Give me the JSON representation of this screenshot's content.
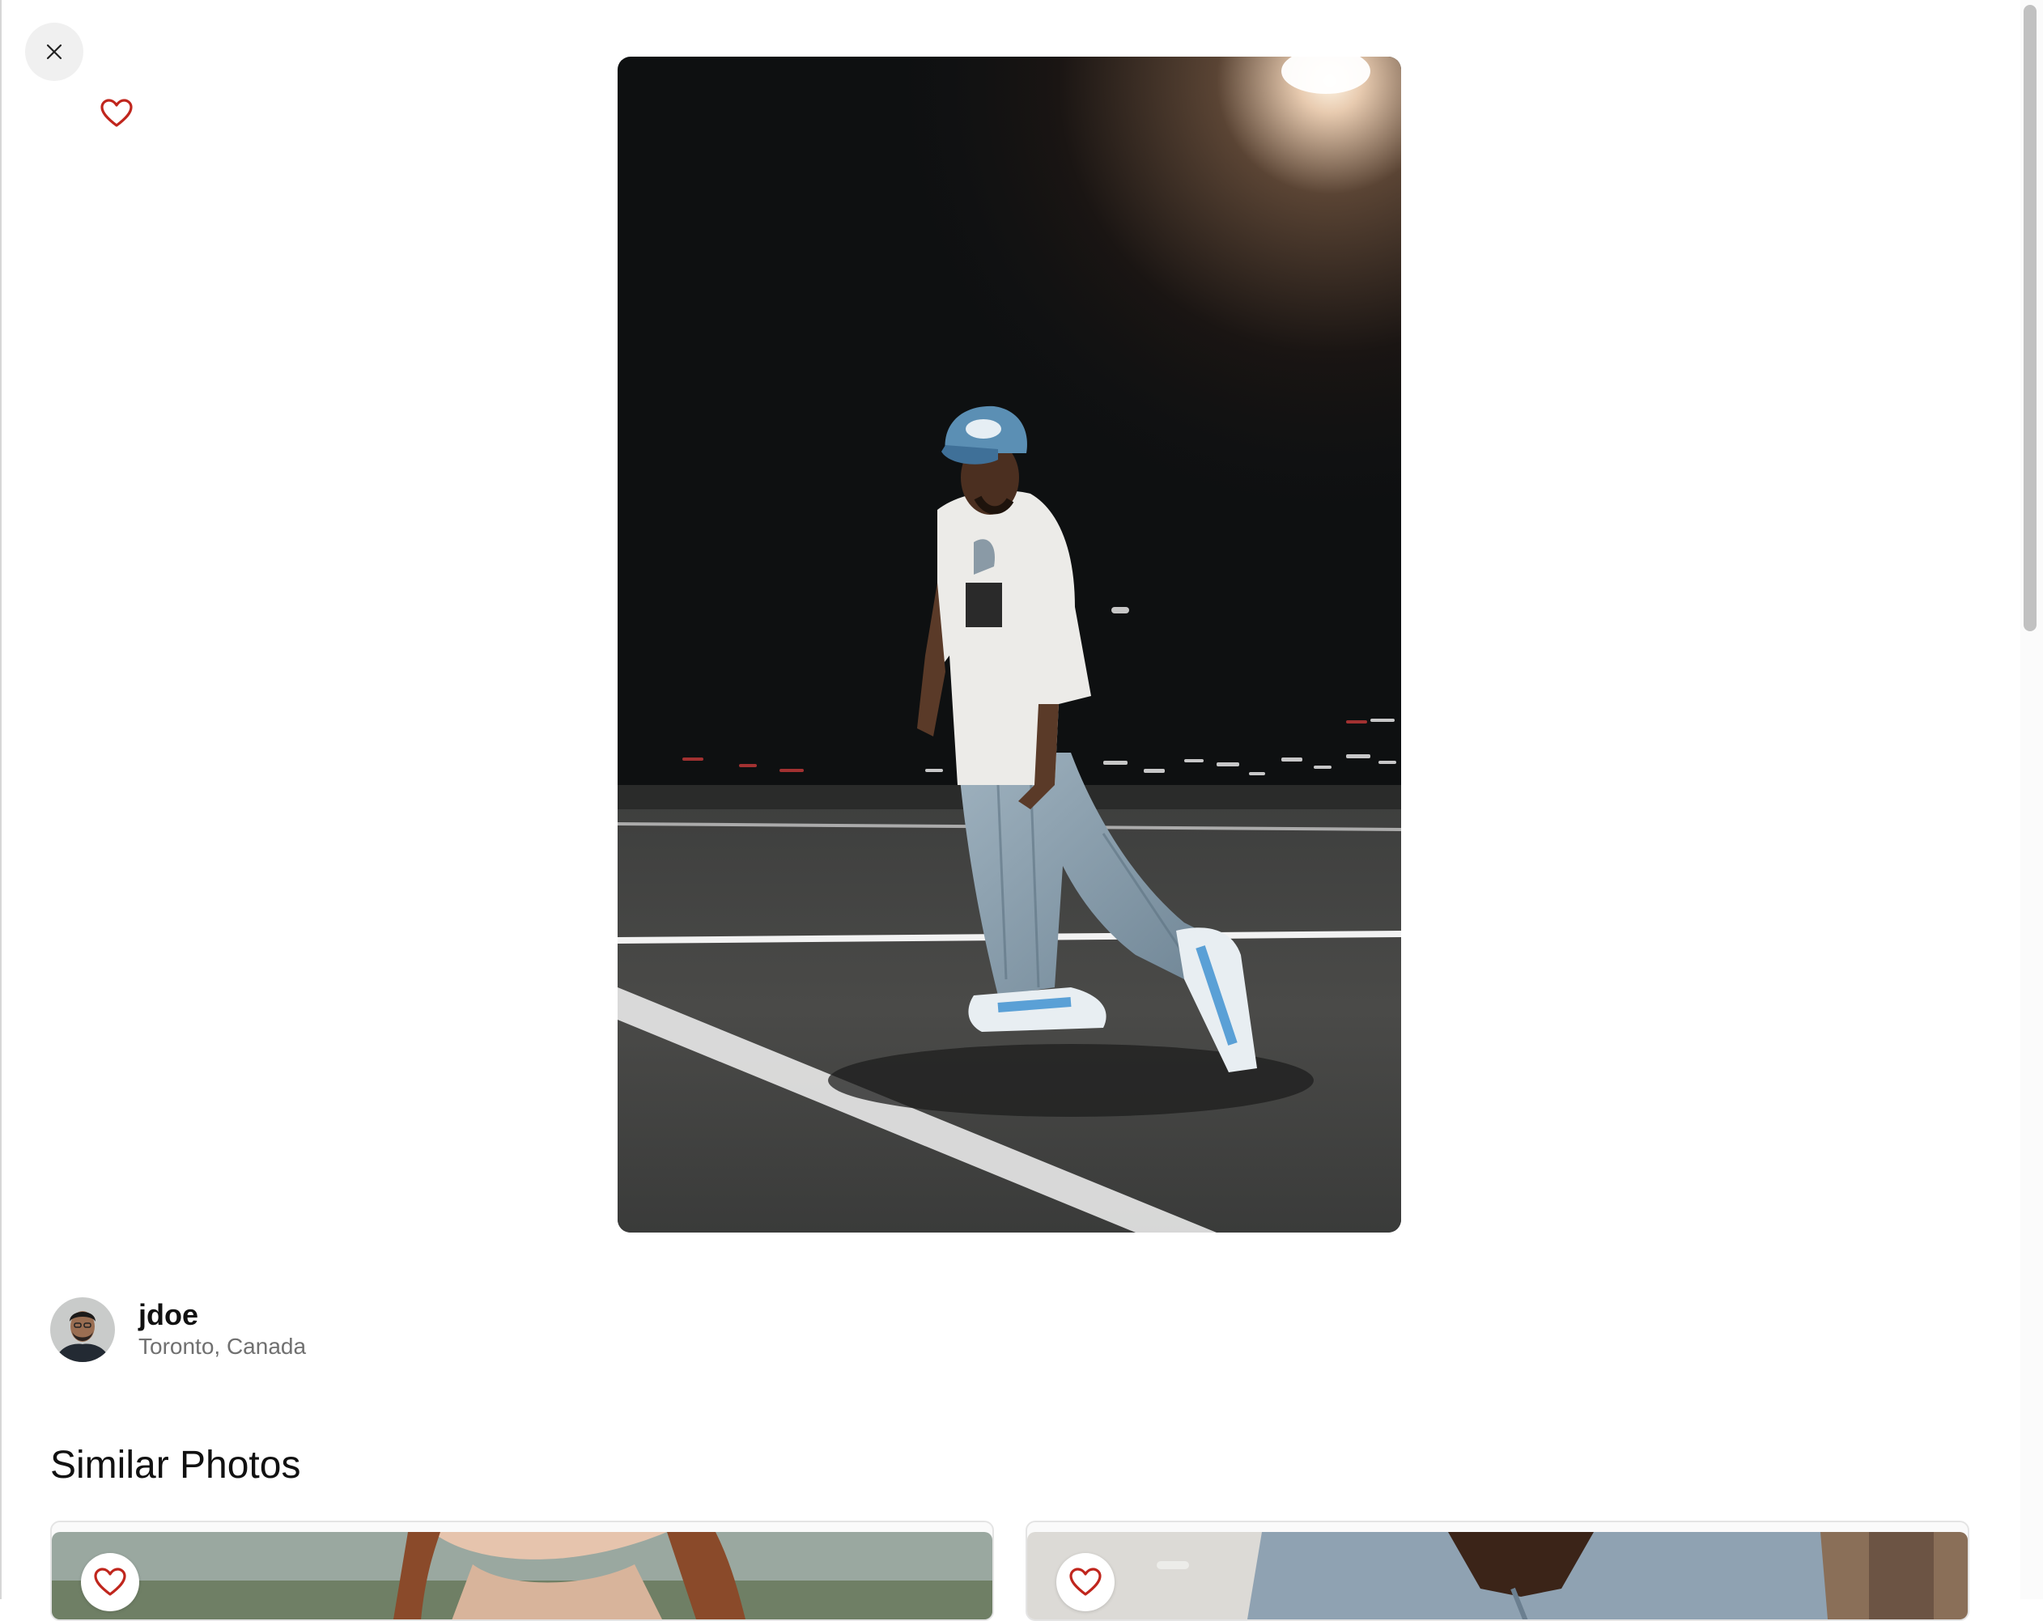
{
  "viewer": {
    "close_icon": "close-icon",
    "favorite_icon": "heart-outline-icon",
    "favorite_color": "#c0261d"
  },
  "photo": {
    "alt": "Man in a blue cap, white t-shirt and baggy jeans walking across a parking lot at night"
  },
  "author": {
    "name": "jdoe",
    "location": "Toronto, Canada"
  },
  "similar": {
    "title": "Similar Photos",
    "cards": [
      {
        "favorite_icon": "heart-outline-icon"
      },
      {
        "favorite_icon": "heart-outline-icon"
      }
    ]
  }
}
